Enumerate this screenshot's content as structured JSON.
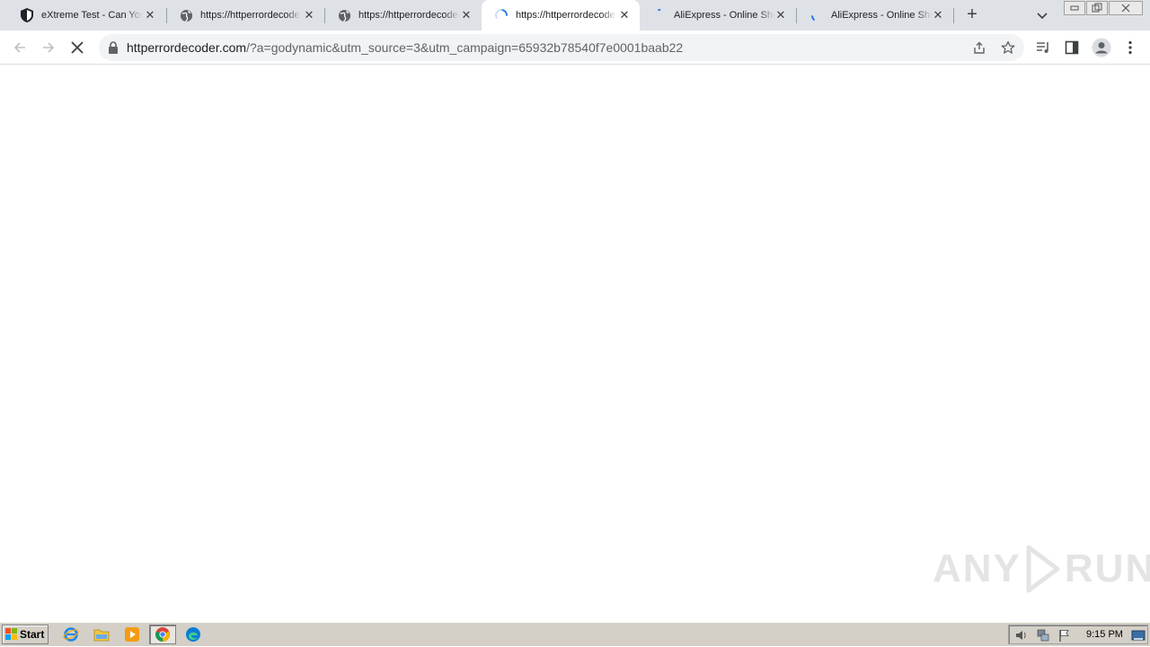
{
  "browser": {
    "tabs": [
      {
        "title": "eXtreme Test - Can You",
        "icon": "shield-icon",
        "active": false
      },
      {
        "title": "https://httperrordecoder",
        "icon": "globe-icon",
        "active": false
      },
      {
        "title": "https://httperrordecoder",
        "icon": "globe-icon",
        "active": false
      },
      {
        "title": "https://httperrordecoder",
        "icon": "loading-spinner-icon",
        "active": true
      },
      {
        "title": "AliExpress - Online Shop",
        "icon": "loading-spinner-icon",
        "active": false
      },
      {
        "title": "AliExpress - Online Shop",
        "icon": "loading-spinner-icon",
        "active": false
      }
    ],
    "close_glyph": "✕",
    "new_tab_glyph": "+",
    "url_host": "httperrordecoder.com",
    "url_path": "/?a=godynamic&utm_source=3&utm_campaign=65932b78540f7e0001baab22"
  },
  "page": {
    "watermark": {
      "left": "ANY",
      "right": "RUN"
    }
  },
  "taskbar": {
    "start_label": "Start",
    "quick_launch": [
      "internet-explorer-icon",
      "file-explorer-icon",
      "media-player-icon",
      "chrome-icon",
      "edge-icon"
    ],
    "clock": "9:15 PM"
  },
  "colors": {
    "tabstrip": "#dee1e6",
    "toolbar": "#ffffff",
    "omnibox": "#f1f3f4",
    "taskbar": "#d4d0c8",
    "accent": "#1a73e8"
  }
}
